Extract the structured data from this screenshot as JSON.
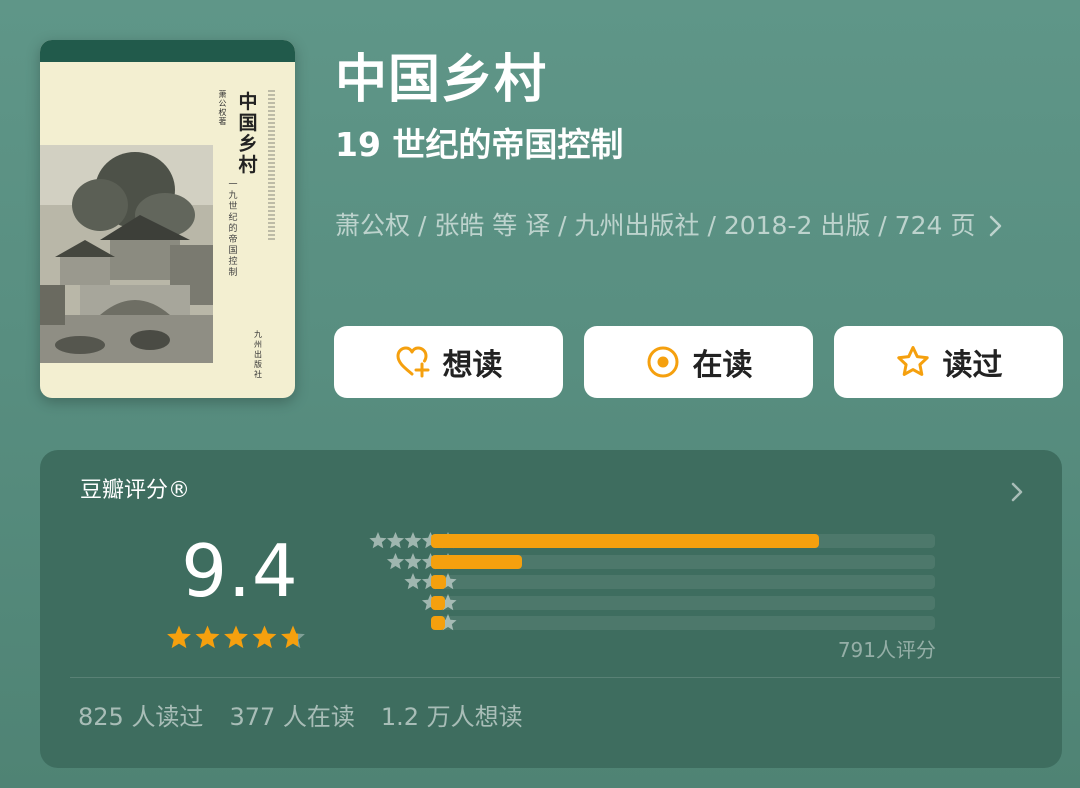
{
  "book": {
    "title": "中国乡村",
    "subtitle": "19 世纪的帝国控制",
    "meta": "萧公权 / 张皓 等 译 / 九州出版社 / 2018-2 出版 / 724 页",
    "cover": {
      "title": "中国乡村",
      "subtitle": "一九世纪的帝国控制",
      "author": "萧公权著",
      "publisher": "九州出版社",
      "icon": "book-cover-image"
    }
  },
  "actions": [
    {
      "label": "想读",
      "icon": "heart-plus-icon"
    },
    {
      "label": "在读",
      "icon": "target-icon"
    },
    {
      "label": "读过",
      "icon": "star-outline-icon"
    }
  ],
  "rating": {
    "label": "豆瓣评分®",
    "score": "9.4",
    "stars_value": 4.7,
    "distribution": [
      {
        "stars": 5,
        "fraction": 0.77
      },
      {
        "stars": 4,
        "fraction": 0.18
      },
      {
        "stars": 3,
        "fraction": 0.03
      },
      {
        "stars": 2,
        "fraction": 0.02
      },
      {
        "stars": 1,
        "fraction": 0.02
      }
    ],
    "count": "791人评分"
  },
  "stats": {
    "read": "825 人读过",
    "reading": "377 人在读",
    "want": "1.2 万人想读"
  },
  "colors": {
    "accent": "#f5a00e",
    "background": "#5b9284",
    "card": "#3e6d5f"
  }
}
